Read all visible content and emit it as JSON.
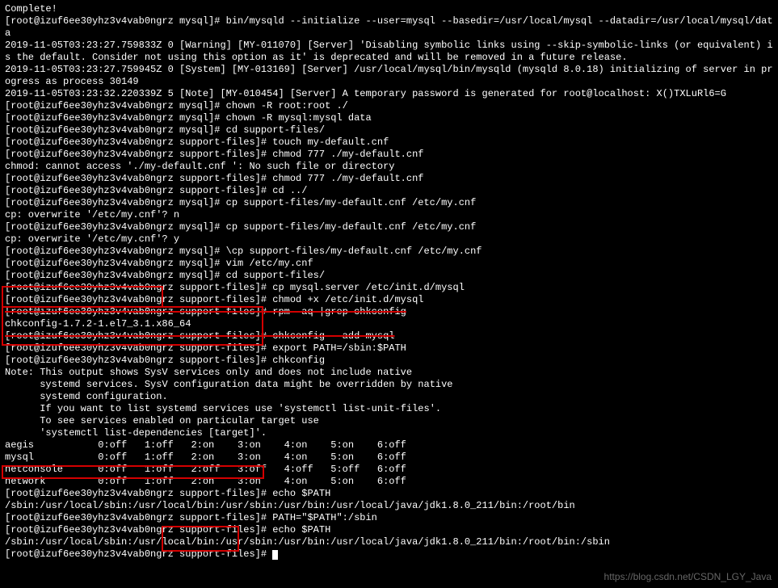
{
  "lines": [
    "Complete!",
    "[root@izuf6ee30yhz3v4vab0ngrz mysql]# bin/mysqld --initialize --user=mysql --basedir=/usr/local/mysql --datadir=/usr/local/mysql/data",
    "2019-11-05T03:23:27.759833Z 0 [Warning] [MY-011070] [Server] 'Disabling symbolic links using --skip-symbolic-links (or equivalent) is the default. Consider not using this option as it' is deprecated and will be removed in a future release.",
    "2019-11-05T03:23:27.759945Z 0 [System] [MY-013169] [Server] /usr/local/mysql/bin/mysqld (mysqld 8.0.18) initializing of server in progress as process 30149",
    "2019-11-05T03:23:32.220339Z 5 [Note] [MY-010454] [Server] A temporary password is generated for root@localhost: X()TXLuRl6=G",
    "[root@izuf6ee30yhz3v4vab0ngrz mysql]# chown -R root:root ./",
    "[root@izuf6ee30yhz3v4vab0ngrz mysql]# chown -R mysql:mysql data",
    "[root@izuf6ee30yhz3v4vab0ngrz mysql]# cd support-files/",
    "[root@izuf6ee30yhz3v4vab0ngrz support-files]# touch my-default.cnf",
    "[root@izuf6ee30yhz3v4vab0ngrz support-files]# chmod 777 ./my-default.cnf",
    "chmod: cannot access './my-default.cnf ': No such file or directory",
    "[root@izuf6ee30yhz3v4vab0ngrz support-files]# chmod 777 ./my-default.cnf",
    "[root@izuf6ee30yhz3v4vab0ngrz support-files]# cd ../",
    "[root@izuf6ee30yhz3v4vab0ngrz mysql]# cp support-files/my-default.cnf /etc/my.cnf",
    "cp: overwrite '/etc/my.cnf'? n",
    "[root@izuf6ee30yhz3v4vab0ngrz mysql]# cp support-files/my-default.cnf /etc/my.cnf",
    "cp: overwrite '/etc/my.cnf'? y",
    "[root@izuf6ee30yhz3v4vab0ngrz mysql]# \\cp support-files/my-default.cnf /etc/my.cnf",
    "[root@izuf6ee30yhz3v4vab0ngrz mysql]# vim /etc/my.cnf",
    "[root@izuf6ee30yhz3v4vab0ngrz mysql]# cd support-files/",
    "[root@izuf6ee30yhz3v4vab0ngrz support-files]# cp mysql.server /etc/init.d/mysql",
    "[root@izuf6ee30yhz3v4vab0ngrz support-files]# chmod +x /etc/init.d/mysql",
    "[root@izuf6ee30yhz3v4vab0ngrz support-files]# rpm -aq |grep chkconfig",
    "chkconfig-1.7.2-1.el7_3.1.x86_64",
    "[root@izuf6ee30yhz3v4vab0ngrz support-files]# chkconfig --add mysql",
    "[root@izuf6ee30yhz3v4vab0ngrz support-files]# export PATH=/sbin:$PATH",
    "[root@izuf6ee30yhz3v4vab0ngrz support-files]# chkconfig",
    "",
    "Note: This output shows SysV services only and does not include native",
    "      systemd services. SysV configuration data might be overridden by native",
    "      systemd configuration.",
    "",
    "      If you want to list systemd services use 'systemctl list-unit-files'.",
    "      To see services enabled on particular target use",
    "      'systemctl list-dependencies [target]'.",
    "",
    "aegis           0:off   1:off   2:on    3:on    4:on    5:on    6:off",
    "mysql           0:off   1:off   2:on    3:on    4:on    5:on    6:off",
    "netconsole      0:off   1:off   2:off   3:off   4:off   5:off   6:off",
    "network         0:off   1:off   2:on    3:on    4:on    5:on    6:off",
    "[root@izuf6ee30yhz3v4vab0ngrz support-files]# echo $PATH",
    "/sbin:/usr/local/sbin:/usr/local/bin:/usr/sbin:/usr/bin:/usr/local/java/jdk1.8.0_211/bin:/root/bin",
    "[root@izuf6ee30yhz3v4vab0ngrz support-files]# PATH=\"$PATH\":/sbin",
    "[root@izuf6ee30yhz3v4vab0ngrz support-files]# echo $PATH",
    "/sbin:/usr/local/sbin:/usr/local/bin:/usr/sbin:/usr/bin:/usr/local/java/jdk1.8.0_211/bin:/root/bin:/sbin",
    "[root@izuf6ee30yhz3v4vab0ngrz support-files]# "
  ],
  "strike_lines": [
    22,
    24
  ],
  "watermark": "https://blog.csdn.net/CSDN_LGY_Java"
}
